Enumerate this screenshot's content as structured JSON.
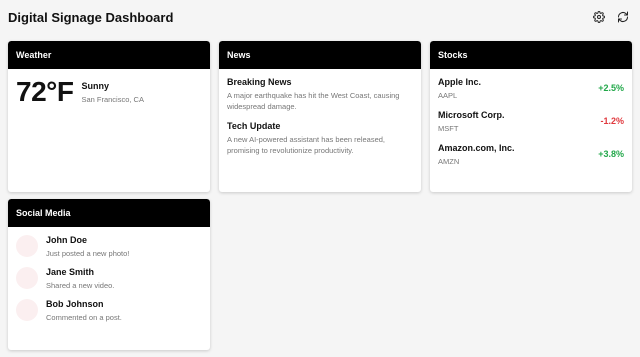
{
  "header": {
    "title": "Digital Signage Dashboard",
    "settings_icon": "gear-icon",
    "refresh_icon": "refresh-icon"
  },
  "weather": {
    "title": "Weather",
    "temperature": "72°F",
    "condition": "Sunny",
    "location": "San Francisco, CA"
  },
  "news": {
    "title": "News",
    "items": [
      {
        "title": "Breaking News",
        "text": "A major earthquake has hit the West Coast, causing widespread damage."
      },
      {
        "title": "Tech Update",
        "text": "A new AI-powered assistant has been released, promising to revolutionize productivity."
      }
    ]
  },
  "stocks": {
    "title": "Stocks",
    "items": [
      {
        "name": "Apple Inc.",
        "ticker": "AAPL",
        "change": "+2.5%"
      },
      {
        "name": "Microsoft Corp.",
        "ticker": "MSFT",
        "change": "-1.2%"
      },
      {
        "name": "Amazon.com, Inc.",
        "ticker": "AMZN",
        "change": "+3.8%"
      }
    ]
  },
  "social": {
    "title": "Social Media",
    "items": [
      {
        "name": "John Doe",
        "text": "Just posted a new photo!"
      },
      {
        "name": "Jane Smith",
        "text": "Shared a new video."
      },
      {
        "name": "Bob Johnson",
        "text": "Commented on a post."
      }
    ]
  },
  "colors": {
    "header_bg": "#000000",
    "positive": "#22a84a",
    "negative": "#e0393e"
  }
}
